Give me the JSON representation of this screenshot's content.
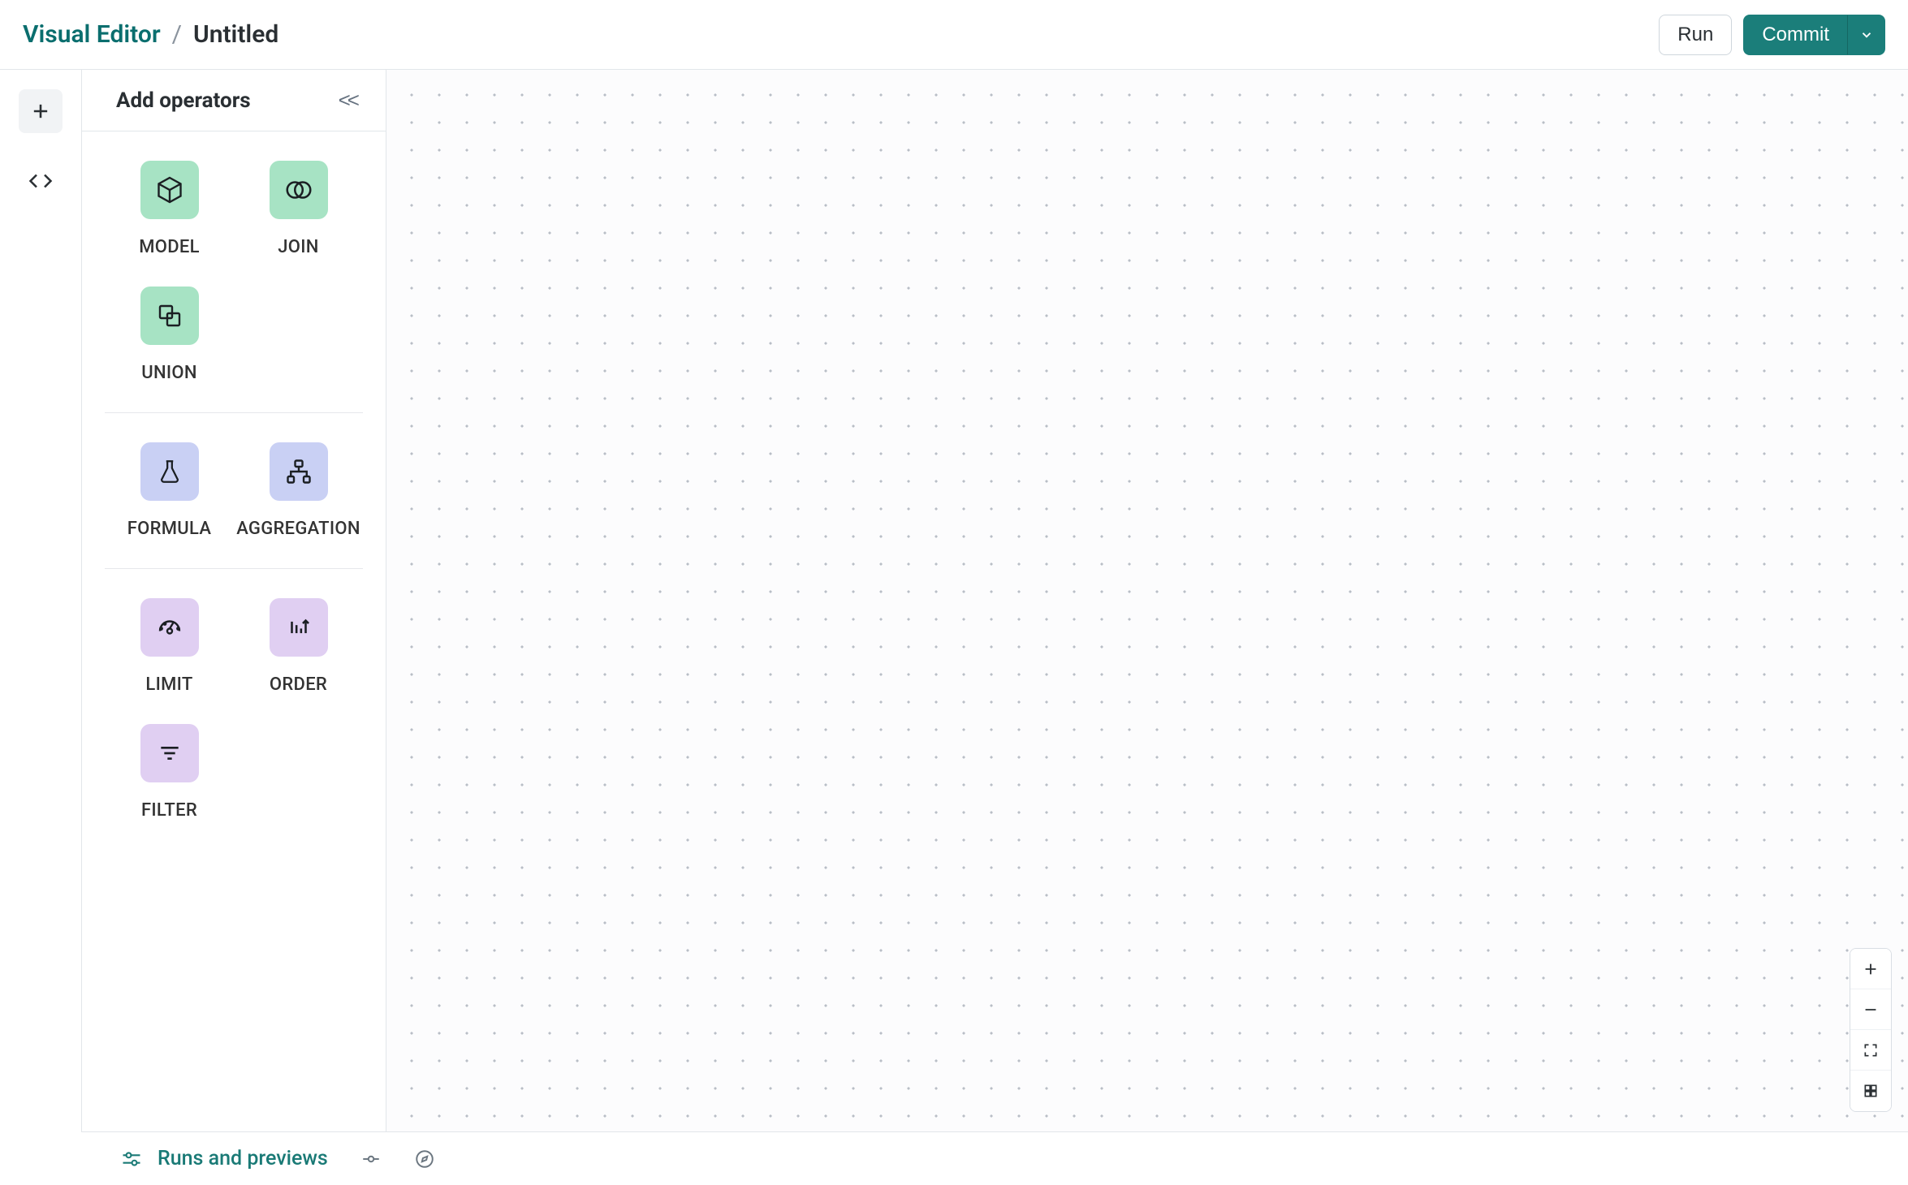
{
  "header": {
    "app_name": "Visual Editor",
    "separator": "/",
    "doc_name": "Untitled",
    "run_label": "Run",
    "commit_label": "Commit"
  },
  "panel": {
    "title": "Add operators"
  },
  "operators": {
    "group1": [
      {
        "label": "MODEL",
        "icon": "cube"
      },
      {
        "label": "JOIN",
        "icon": "venn"
      },
      {
        "label": "UNION",
        "icon": "shapes"
      }
    ],
    "group2": [
      {
        "label": "FORMULA",
        "icon": "flask"
      },
      {
        "label": "AGGREGATION",
        "icon": "hierarchy"
      }
    ],
    "group3": [
      {
        "label": "LIMIT",
        "icon": "gauge"
      },
      {
        "label": "ORDER",
        "icon": "sort"
      },
      {
        "label": "FILTER",
        "icon": "lines"
      }
    ]
  },
  "bottom": {
    "runs_label": "Runs and previews"
  }
}
